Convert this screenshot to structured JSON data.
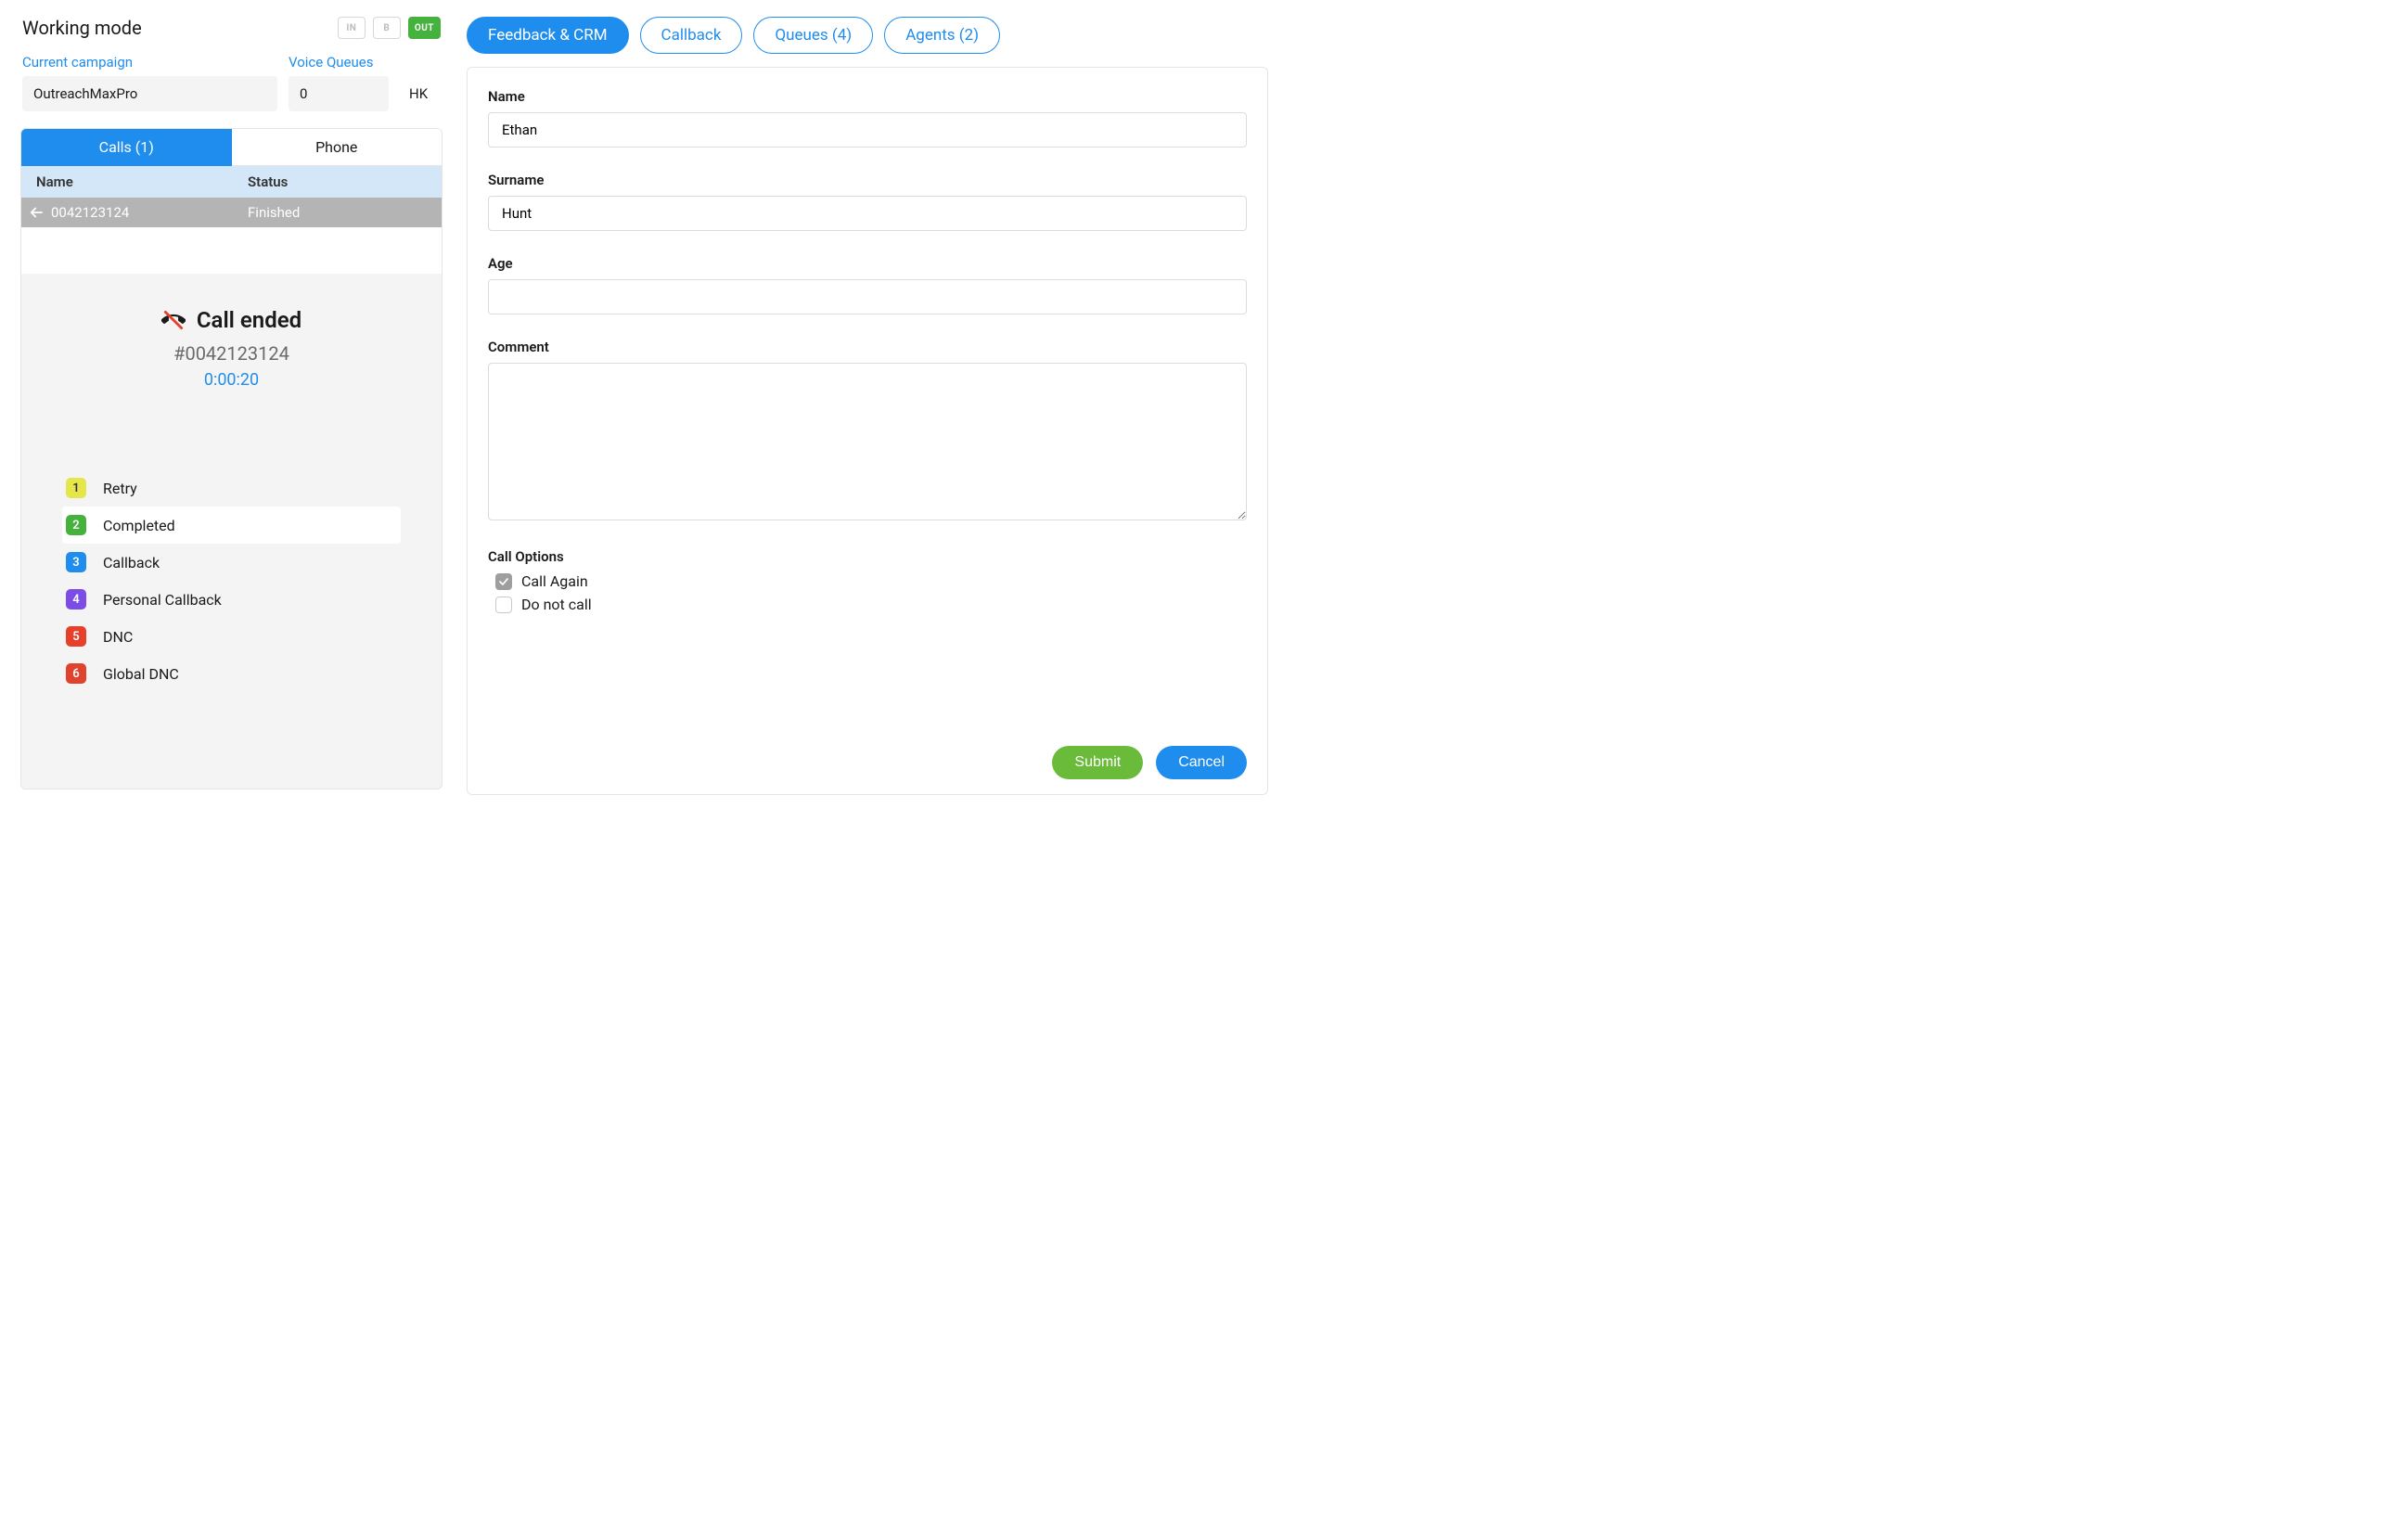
{
  "working": {
    "title": "Working mode",
    "modes": [
      {
        "key": "in",
        "label": "IN",
        "active": false
      },
      {
        "key": "b",
        "label": "B",
        "active": false
      },
      {
        "key": "out",
        "label": "OUT",
        "active": true
      }
    ],
    "campaign": {
      "label": "Current campaign",
      "value": "OutreachMaxPro"
    },
    "voice_queues": {
      "label": "Voice Queues",
      "value": "0"
    },
    "hk": "HK"
  },
  "left_panel": {
    "tabs": [
      {
        "key": "calls",
        "label": "Calls (1)",
        "active": true
      },
      {
        "key": "phone",
        "label": "Phone",
        "active": false
      }
    ],
    "columns": {
      "name": "Name",
      "status": "Status"
    },
    "rows": [
      {
        "number": "0042123124",
        "status": "Finished"
      }
    ],
    "call_summary": {
      "title": "Call ended",
      "number": "#0042123124",
      "duration": "0:00:20",
      "dispositions": [
        {
          "num": "1",
          "label": "Retry",
          "color": "c-yellow",
          "selected": false
        },
        {
          "num": "2",
          "label": "Completed",
          "color": "c-green",
          "selected": true
        },
        {
          "num": "3",
          "label": "Callback",
          "color": "c-blue",
          "selected": false
        },
        {
          "num": "4",
          "label": "Personal Callback",
          "color": "c-purple",
          "selected": false
        },
        {
          "num": "5",
          "label": "DNC",
          "color": "c-red",
          "selected": false
        },
        {
          "num": "6",
          "label": "Global DNC",
          "color": "c-red-dark",
          "selected": false
        }
      ]
    }
  },
  "right": {
    "tabs": [
      {
        "key": "feedback",
        "label": "Feedback & CRM",
        "active": true
      },
      {
        "key": "callback",
        "label": "Callback",
        "active": false
      },
      {
        "key": "queues",
        "label": "Queues (4)",
        "active": false
      },
      {
        "key": "agents",
        "label": "Agents (2)",
        "active": false
      }
    ],
    "form": {
      "name": {
        "label": "Name",
        "value": "Ethan"
      },
      "surname": {
        "label": "Surname",
        "value": "Hunt"
      },
      "age": {
        "label": "Age",
        "value": ""
      },
      "comment": {
        "label": "Comment",
        "value": ""
      },
      "call_options": {
        "label": "Call Options",
        "call_again": {
          "label": "Call Again",
          "checked": true
        },
        "do_not_call": {
          "label": "Do not call",
          "checked": false
        }
      },
      "actions": {
        "submit": "Submit",
        "cancel": "Cancel"
      }
    }
  }
}
